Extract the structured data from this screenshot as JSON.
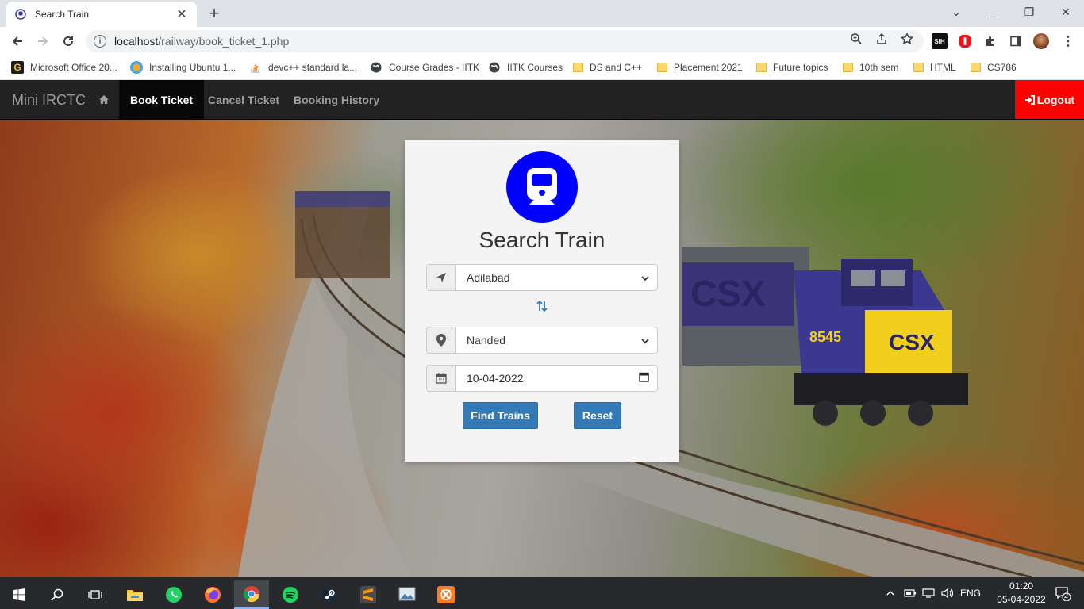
{
  "browser": {
    "tab_title": "Search Train",
    "url_host": "localhost",
    "url_path": "/railway/book_ticket_1.php",
    "bookmarks": [
      {
        "label": "Microsoft Office 20...",
        "icon": "office-icon"
      },
      {
        "label": "Installing Ubuntu 1...",
        "icon": "ubuntu-icon"
      },
      {
        "label": "devc++ standard la...",
        "icon": "stackoverflow-icon"
      },
      {
        "label": "Course Grades - IITK",
        "icon": "globe-icon"
      },
      {
        "label": "IITK Courses",
        "icon": "globe-icon"
      },
      {
        "label": "DS and C++",
        "icon": "folder-icon"
      },
      {
        "label": "Placement 2021",
        "icon": "folder-icon"
      },
      {
        "label": "Future topics",
        "icon": "folder-icon"
      },
      {
        "label": "10th sem",
        "icon": "folder-icon"
      },
      {
        "label": "HTML",
        "icon": "folder-icon"
      },
      {
        "label": "CS786",
        "icon": "folder-icon"
      }
    ],
    "extension_badge": "SIH"
  },
  "site": {
    "brand": "Mini IRCTC",
    "nav": {
      "book": "Book Ticket",
      "cancel": "Cancel Ticket",
      "history": "Booking History",
      "logout": "Logout"
    }
  },
  "search": {
    "title": "Search Train",
    "from_value": "Adilabad",
    "to_value": "Nanded",
    "date_value": "10-04-2022",
    "find_label": "Find Trains",
    "reset_label": "Reset"
  },
  "taskbar": {
    "lang": "ENG",
    "time": "01:20",
    "date": "05-04-2022",
    "notifications": "2"
  },
  "colors": {
    "navbar": "#222222",
    "logout": "#ff0000",
    "logo_circle": "#0000ff",
    "button": "#337ab7"
  }
}
